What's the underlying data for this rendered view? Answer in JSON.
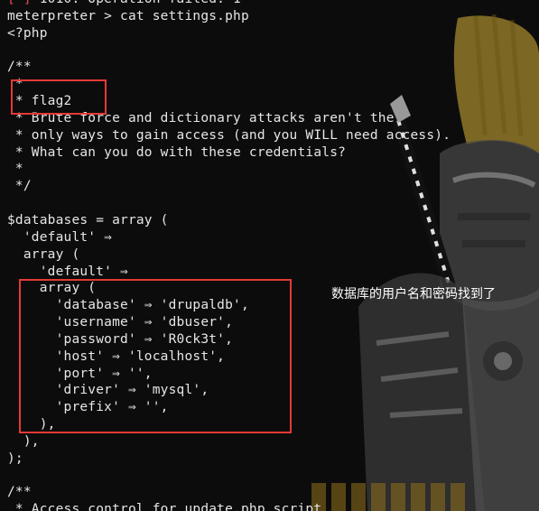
{
  "terminal": {
    "lines": [
      "[-] 1010: Operation failed: 1",
      "meterpreter > cat settings.php",
      "<?php",
      "",
      "/**",
      " *",
      " * flag2",
      " * Brute force and dictionary attacks aren't the",
      " * only ways to gain access (and you WILL need access).",
      " * What can you do with these credentials?",
      " *",
      " */",
      "",
      "$databases = array (",
      "  'default' ⇒",
      "  array (",
      "    'default' ⇒",
      "    array (",
      "      'database' ⇒ 'drupaldb',",
      "      'username' ⇒ 'dbuser',",
      "      'password' ⇒ 'R0ck3t',",
      "      'host' ⇒ 'localhost',",
      "      'port' ⇒ '',",
      "      'driver' ⇒ 'mysql',",
      "      'prefix' ⇒ '',",
      "    ),",
      "  ),",
      ");",
      "",
      "/**",
      " * Access control for update.php script"
    ]
  },
  "annotation": {
    "text": "数据库的用户名和密码找到了"
  },
  "colors": {
    "background": "#0c0c0c",
    "text": "#e6e6e6",
    "highlight_box": "#e53935",
    "error_prefix": "#e74856"
  }
}
